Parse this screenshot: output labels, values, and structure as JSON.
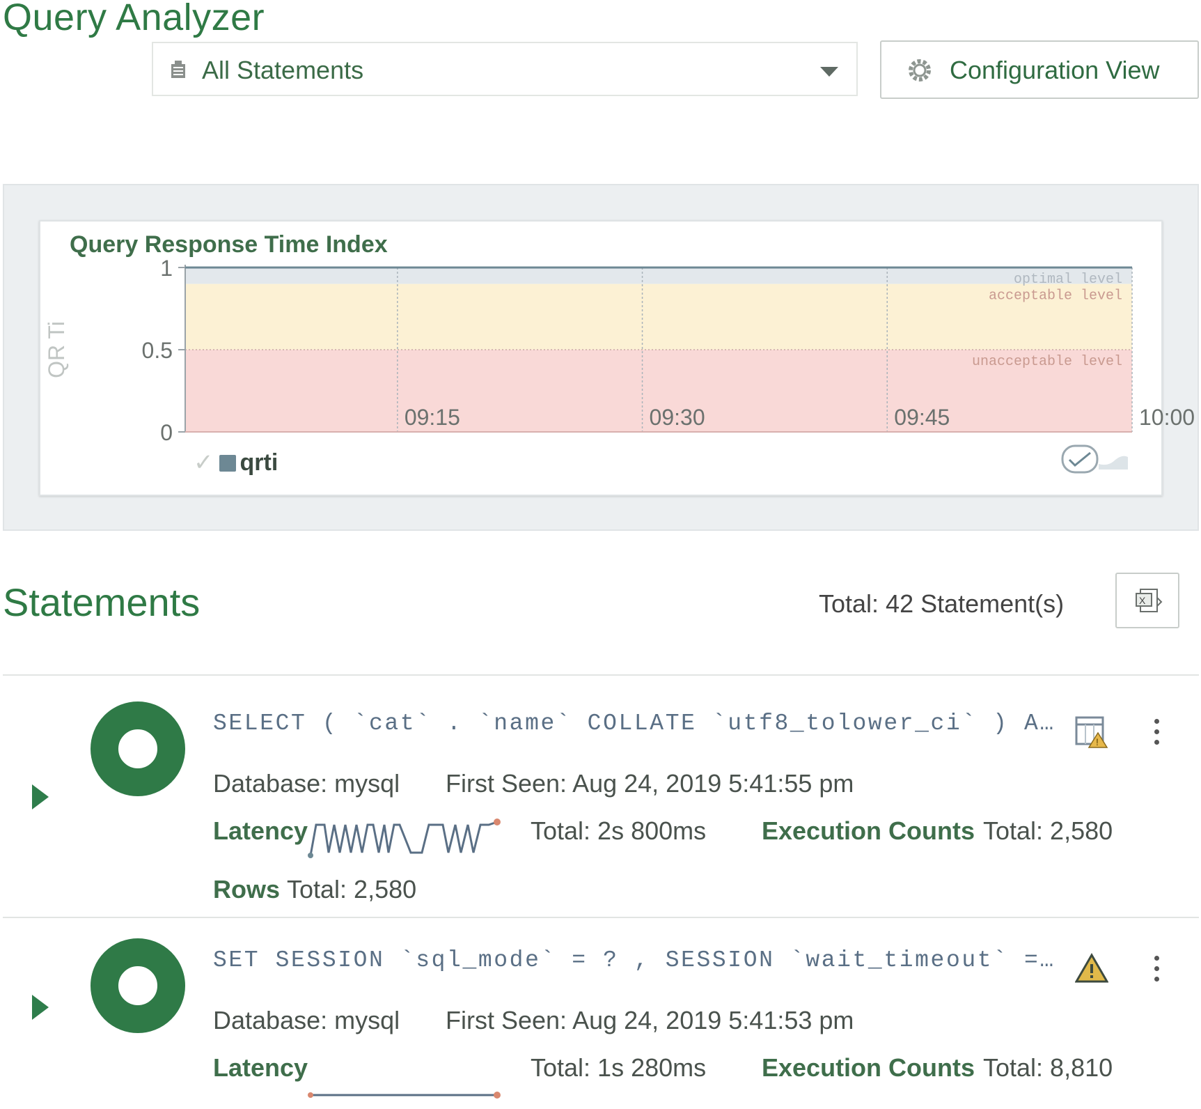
{
  "page_title": "Query Analyzer",
  "statement_filter": {
    "selected": "All Statements",
    "icon": "database-icon"
  },
  "config_button": {
    "label": "Configuration View",
    "icon": "gear-icon"
  },
  "chart": {
    "title": "Query Response Time Index",
    "legend": "qrti",
    "colors": {
      "optimal": "#e3e8ec",
      "acceptable": "#fcf1d4",
      "unacceptable": "#f9d9d7",
      "legend_swatch": "#6d8894"
    },
    "chart_data": {
      "type": "line",
      "title": "Query Response Time Index",
      "ylabel": "QR Ti",
      "xlabel": "",
      "ylim": [
        0,
        1
      ],
      "y_ticks": [
        "0",
        "0.5",
        "1"
      ],
      "x_ticks": [
        "09:15",
        "09:30",
        "09:45",
        "10:00"
      ],
      "bands": [
        {
          "label": "optimal level",
          "from": 0.9,
          "to": 1.0
        },
        {
          "label": "acceptable level",
          "from": 0.5,
          "to": 0.9
        },
        {
          "label": "unacceptable level",
          "from": 0.0,
          "to": 0.5
        }
      ],
      "series": [
        {
          "name": "qrti",
          "x": [
            "09:02",
            "10:00"
          ],
          "values": [
            1,
            1
          ]
        }
      ],
      "grid": true,
      "legend_position": "bottom-left"
    }
  },
  "statements": {
    "title": "Statements",
    "total": "Total: 42 Statement(s)",
    "export_icon": "excel-export-icon",
    "items": [
      {
        "sql": "SELECT ( `cat` . `name` COLLATE `utf8_tolower_ci` ) A…",
        "database_label": "Database:",
        "database": "mysql",
        "first_seen_label": "First Seen:",
        "first_seen": "Aug 24, 2019 5:41:55 pm",
        "latency_label": "Latency",
        "latency_total": "Total: 2s 800ms",
        "exec_label": "Execution Counts",
        "exec_total": "Total: 2,580",
        "rows_label": "Rows",
        "rows_total": "Total: 2,580",
        "status_icon": "table-warning-icon"
      },
      {
        "sql": "SET SESSION `sql_mode` = ? , SESSION `wait_timeout` =…",
        "database_label": "Database:",
        "database": "mysql",
        "first_seen_label": "First Seen:",
        "first_seen": "Aug 24, 2019 5:41:53 pm",
        "latency_label": "Latency",
        "latency_total": "Total: 1s 280ms",
        "exec_label": "Execution Counts",
        "exec_total": "Total: 8,810",
        "status_icon": "warning-icon"
      }
    ]
  }
}
